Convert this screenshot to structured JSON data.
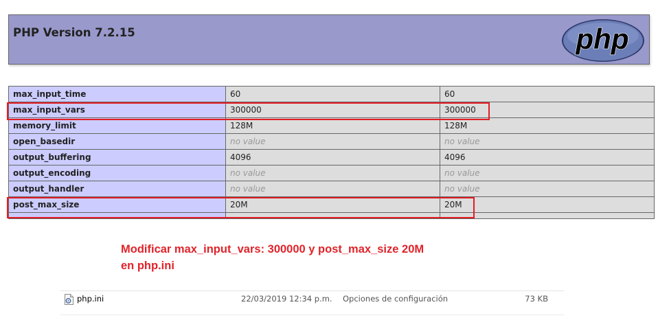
{
  "header": {
    "title": "PHP Version 7.2.15",
    "logo_text": "php",
    "colors": {
      "header_bg": "#9999cc",
      "logo_bg": "#6c7eb7",
      "logo_text": "#000000"
    }
  },
  "config_table": {
    "rows": [
      {
        "directive": "max_input_time",
        "local": "60",
        "master": "60"
      },
      {
        "directive": "max_input_vars",
        "local": "300000",
        "master": "300000"
      },
      {
        "directive": "memory_limit",
        "local": "128M",
        "master": "128M"
      },
      {
        "directive": "open_basedir",
        "local": "no value",
        "master": "no value"
      },
      {
        "directive": "output_buffering",
        "local": "4096",
        "master": "4096"
      },
      {
        "directive": "output_encoding",
        "local": "no value",
        "master": "no value"
      },
      {
        "directive": "output_handler",
        "local": "no value",
        "master": "no value"
      },
      {
        "directive": "post_max_size",
        "local": "20M",
        "master": "20M"
      }
    ],
    "colors": {
      "key_bg": "#ccccff",
      "value_bg": "#dddddd",
      "no_value_text": "#999999"
    }
  },
  "annotation": {
    "line1": "Modificar max_input_vars: 300000 y post_max_size 20M",
    "line2": "en php.ini",
    "color": "#e0232a",
    "highlight_color": "#e31c23"
  },
  "file_row": {
    "icon": "settings-file-icon",
    "name": "php.ini",
    "date_modified": "22/03/2019 12:34 p.m.",
    "type": "Opciones de configuración",
    "size": "73 KB"
  }
}
